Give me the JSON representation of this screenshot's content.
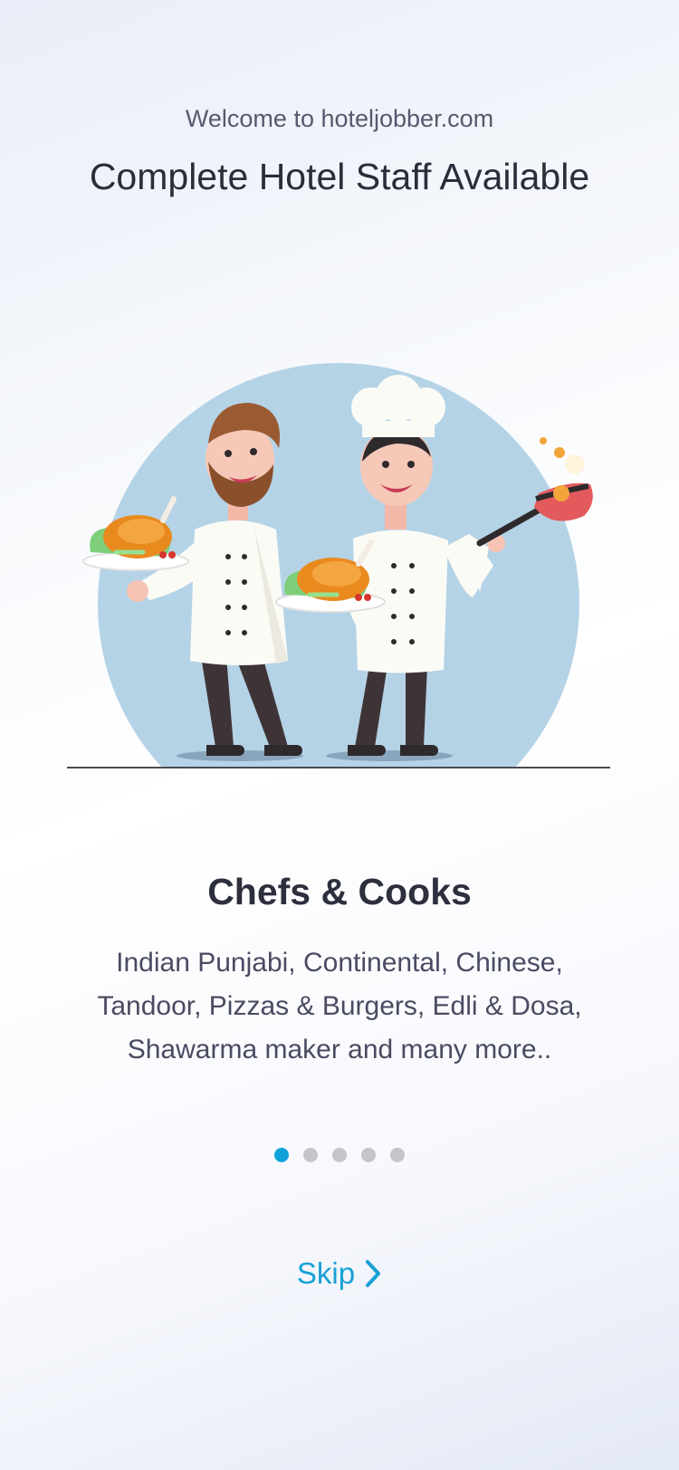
{
  "header": {
    "welcome": "Welcome to hoteljobber.com",
    "headline": "Complete Hotel Staff Available"
  },
  "slide": {
    "title": "Chefs & Cooks",
    "description": "Indian Punjabi, Continental, Chinese, Tandoor, Pizzas & Burgers, Edli & Dosa, Shawarma maker and many more..",
    "illustration_icon": "chefs-illustration-icon"
  },
  "pagination": {
    "total": 5,
    "active_index": 0,
    "active_color": "#0ea2d8",
    "inactive_color": "#c4c5c9"
  },
  "footer": {
    "skip_label": "Skip",
    "skip_icon": "chevron-right-icon",
    "accent_color": "#17a0d4"
  }
}
